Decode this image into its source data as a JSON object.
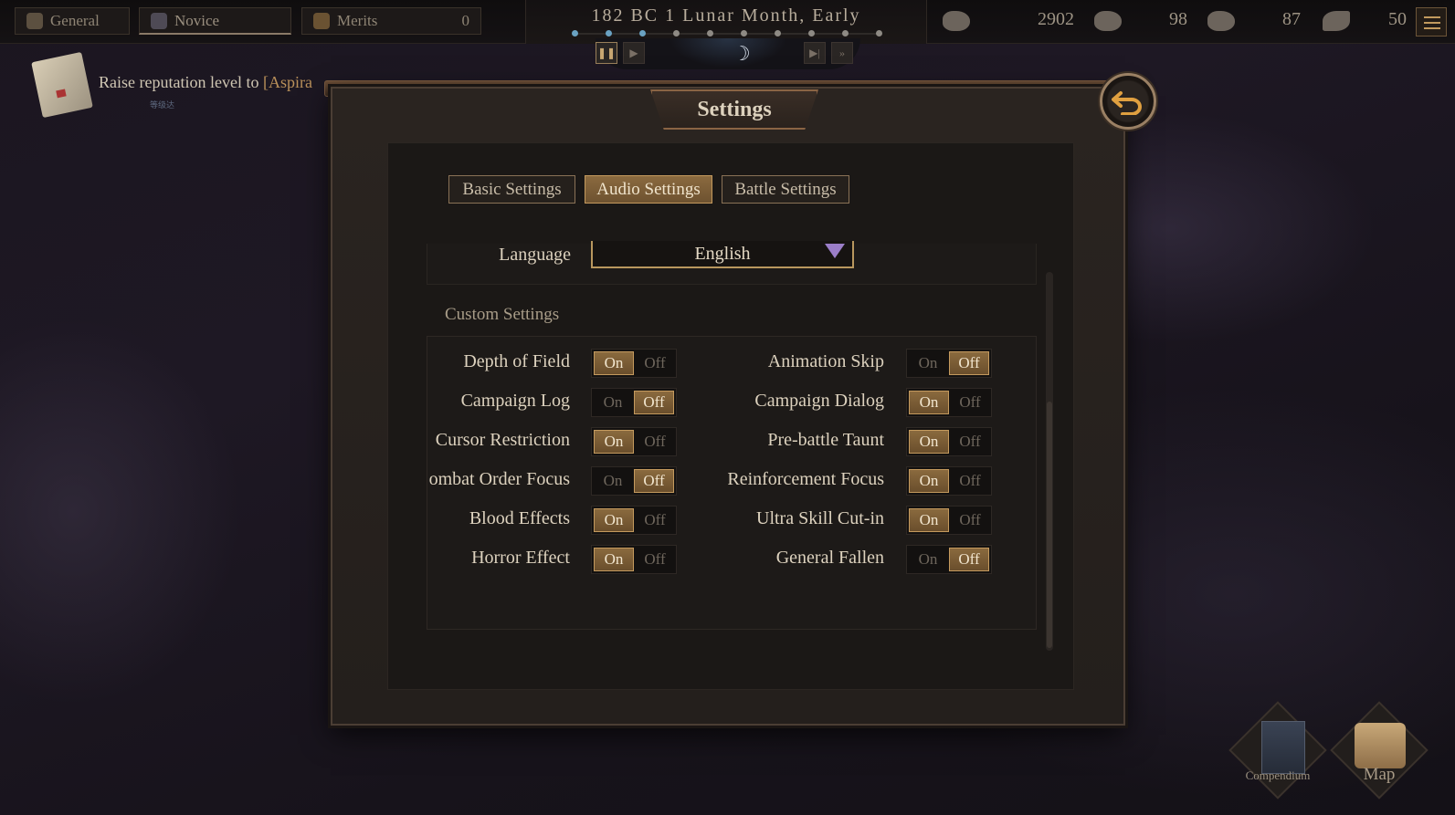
{
  "topbar": {
    "tabs": [
      {
        "label": "General",
        "icon": "helmet-icon"
      },
      {
        "label": "Novice",
        "icon": "rank-badge-icon"
      },
      {
        "label": "Merits",
        "icon": "merits-icon",
        "count": "0"
      }
    ],
    "date": "182 BC 1 Lunar Month, Early",
    "resources": [
      {
        "icon": "coins-icon",
        "value": "2902"
      },
      {
        "icon": "grain-icon",
        "value": "98"
      },
      {
        "icon": "ore-icon",
        "value": "87"
      },
      {
        "icon": "scroll-icon",
        "value": "50"
      }
    ]
  },
  "quest": {
    "text": "Raise reputation level to ",
    "highlight": "[Aspira",
    "sub": "等级达"
  },
  "settings": {
    "title": "Settings",
    "tabs": [
      "Basic Settings",
      "Audio Settings",
      "Battle Settings"
    ],
    "active_tab": 1,
    "language_label": "Language",
    "language_value": "English",
    "custom_title": "Custom Settings",
    "on_label": "On",
    "off_label": "Off",
    "left_options": [
      {
        "label": "Depth of Field",
        "value": "On"
      },
      {
        "label": "Campaign Log",
        "value": "Off"
      },
      {
        "label": "Cursor Restriction",
        "value": "On"
      },
      {
        "label": "ombat Order Focus",
        "value": "Off"
      },
      {
        "label": "Blood Effects",
        "value": "On"
      },
      {
        "label": "Horror Effect",
        "value": "On"
      }
    ],
    "right_options": [
      {
        "label": "Animation Skip",
        "value": "Off"
      },
      {
        "label": "Campaign Dialog",
        "value": "On"
      },
      {
        "label": "Pre-battle Taunt",
        "value": "On"
      },
      {
        "label": "Reinforcement Focus",
        "value": "On"
      },
      {
        "label": "Ultra Skill Cut-in",
        "value": "On"
      },
      {
        "label": "General Fallen",
        "value": "Off"
      }
    ]
  },
  "bottom": {
    "compendium_label": "Compendium",
    "map_label": "Map"
  },
  "colors": {
    "accent_gold": "#c49a5e",
    "selected_fill": "#8a6a3e",
    "dropdown_arrow": "#9b7ec8"
  }
}
